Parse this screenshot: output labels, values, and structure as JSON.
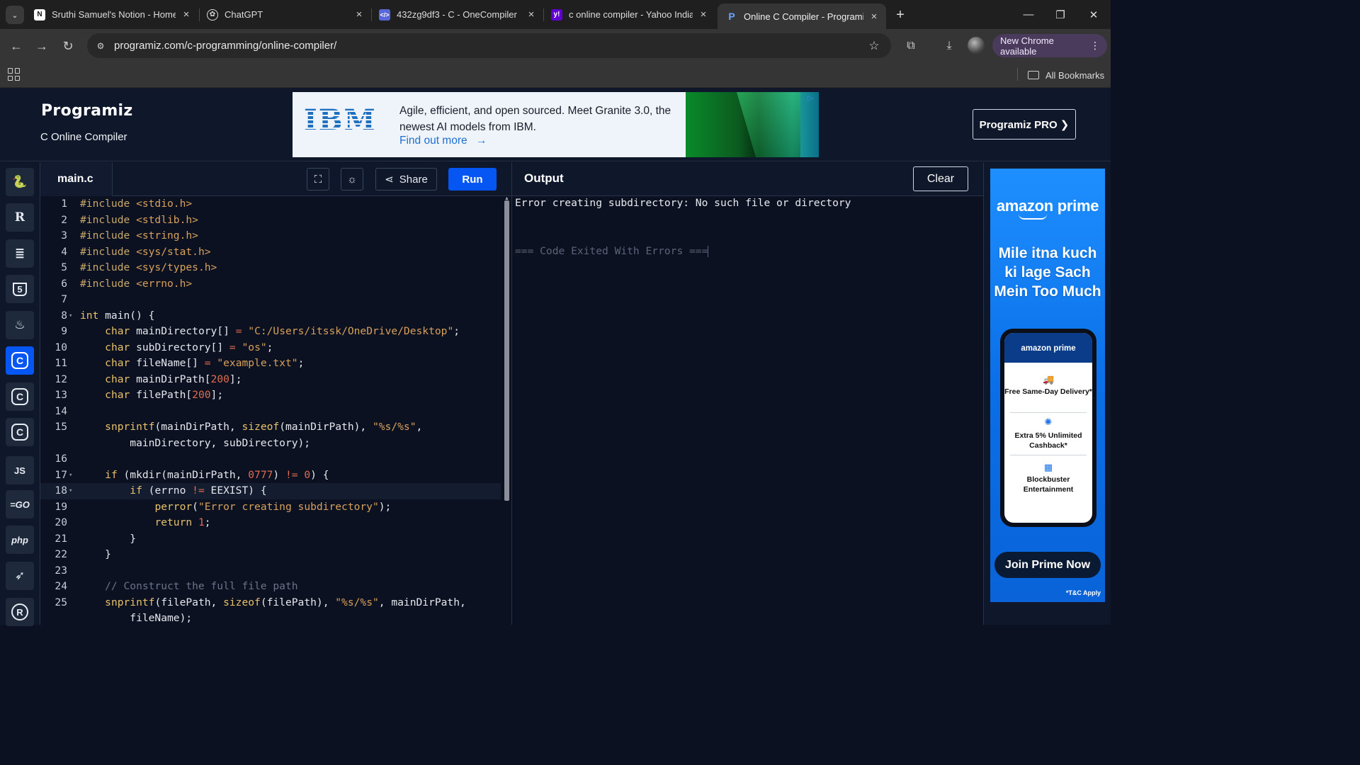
{
  "browser": {
    "tabs": [
      {
        "title": "Sruthi Samuel's Notion - Home",
        "favicon": "notion-icon",
        "active": false
      },
      {
        "title": "ChatGPT",
        "favicon": "chatgpt-icon",
        "active": false
      },
      {
        "title": "432zg9df3 - C - OneCompiler",
        "favicon": "onecompiler-icon",
        "active": false
      },
      {
        "title": "c online compiler - Yahoo India",
        "favicon": "yahoo-icon",
        "active": false
      },
      {
        "title": "Online C Compiler - Programiz",
        "favicon": "programiz-icon",
        "active": true
      }
    ],
    "url": "programiz.com/c-programming/online-compiler/",
    "new_chrome_label": "New Chrome available",
    "all_bookmarks_label": "All Bookmarks"
  },
  "header": {
    "logo": "Programiz",
    "subtitle": "C Online Compiler",
    "pro_button": "Programiz PRO ❯"
  },
  "ad_banner": {
    "brand": "IBM",
    "text": "Agile, efficient, and open sourced. Meet Granite 3.0, the newest AI models from IBM.",
    "link": "Find out more"
  },
  "sidebar": {
    "languages": [
      {
        "name": "python",
        "glyph": "🐍",
        "active": false
      },
      {
        "name": "r",
        "glyph": "R",
        "active": false
      },
      {
        "name": "sql",
        "glyph": "≣",
        "active": false
      },
      {
        "name": "html",
        "glyph": "5",
        "active": false
      },
      {
        "name": "java",
        "glyph": "♨",
        "active": false
      },
      {
        "name": "c",
        "glyph": "C",
        "active": true
      },
      {
        "name": "cpp",
        "glyph": "C",
        "active": false
      },
      {
        "name": "csharp",
        "glyph": "C",
        "active": false
      },
      {
        "name": "javascript",
        "glyph": "JS",
        "active": false
      },
      {
        "name": "go",
        "glyph": "GO",
        "active": false
      },
      {
        "name": "php",
        "glyph": "php",
        "active": false
      },
      {
        "name": "swift",
        "glyph": "➤",
        "active": false
      },
      {
        "name": "rust",
        "glyph": "R",
        "active": false
      }
    ]
  },
  "editor": {
    "file_name": "main.c",
    "share_label": "Share",
    "run_label": "Run",
    "highlighted_line": 18,
    "lines": [
      {
        "n": "1",
        "fold": false,
        "tokens": [
          [
            "pp",
            "#include "
          ],
          [
            "str",
            "<stdio.h>"
          ]
        ]
      },
      {
        "n": "2",
        "fold": false,
        "tokens": [
          [
            "pp",
            "#include "
          ],
          [
            "str",
            "<stdlib.h>"
          ]
        ]
      },
      {
        "n": "3",
        "fold": false,
        "tokens": [
          [
            "pp",
            "#include "
          ],
          [
            "str",
            "<string.h>"
          ]
        ]
      },
      {
        "n": "4",
        "fold": false,
        "tokens": [
          [
            "pp",
            "#include "
          ],
          [
            "str",
            "<sys/stat.h>"
          ]
        ]
      },
      {
        "n": "5",
        "fold": false,
        "tokens": [
          [
            "pp",
            "#include "
          ],
          [
            "str",
            "<sys/types.h>"
          ]
        ]
      },
      {
        "n": "6",
        "fold": false,
        "tokens": [
          [
            "pp",
            "#include "
          ],
          [
            "str",
            "<errno.h>"
          ]
        ]
      },
      {
        "n": "7",
        "fold": false,
        "tokens": []
      },
      {
        "n": "8",
        "fold": true,
        "tokens": [
          [
            "kw",
            "int"
          ],
          [
            "plain",
            " main() {"
          ]
        ]
      },
      {
        "n": "9",
        "fold": false,
        "tokens": [
          [
            "plain",
            "    "
          ],
          [
            "kw",
            "char"
          ],
          [
            "plain",
            " mainDirectory[] "
          ],
          [
            "op",
            "="
          ],
          [
            "plain",
            " "
          ],
          [
            "str",
            "\"C:/Users/itssk/OneDrive/Desktop\""
          ],
          [
            "plain",
            ";"
          ]
        ]
      },
      {
        "n": "10",
        "fold": false,
        "tokens": [
          [
            "plain",
            "    "
          ],
          [
            "kw",
            "char"
          ],
          [
            "plain",
            " subDirectory[] "
          ],
          [
            "op",
            "="
          ],
          [
            "plain",
            " "
          ],
          [
            "str",
            "\"os\""
          ],
          [
            "plain",
            ";"
          ]
        ]
      },
      {
        "n": "11",
        "fold": false,
        "tokens": [
          [
            "plain",
            "    "
          ],
          [
            "kw",
            "char"
          ],
          [
            "plain",
            " fileName[] "
          ],
          [
            "op",
            "="
          ],
          [
            "plain",
            " "
          ],
          [
            "str",
            "\"example.txt\""
          ],
          [
            "plain",
            ";"
          ]
        ]
      },
      {
        "n": "12",
        "fold": false,
        "tokens": [
          [
            "plain",
            "    "
          ],
          [
            "kw",
            "char"
          ],
          [
            "plain",
            " mainDirPath["
          ],
          [
            "num",
            "200"
          ],
          [
            "plain",
            "];"
          ]
        ]
      },
      {
        "n": "13",
        "fold": false,
        "tokens": [
          [
            "plain",
            "    "
          ],
          [
            "kw",
            "char"
          ],
          [
            "plain",
            " filePath["
          ],
          [
            "num",
            "200"
          ],
          [
            "plain",
            "];"
          ]
        ]
      },
      {
        "n": "14",
        "fold": false,
        "tokens": []
      },
      {
        "n": "15",
        "fold": false,
        "tokens": [
          [
            "plain",
            "    "
          ],
          [
            "kw",
            "snprintf"
          ],
          [
            "plain",
            "(mainDirPath, "
          ],
          [
            "kw",
            "sizeof"
          ],
          [
            "plain",
            "(mainDirPath), "
          ],
          [
            "str",
            "\"%s/%s\""
          ],
          [
            "plain",
            ","
          ]
        ]
      },
      {
        "n": "",
        "fold": false,
        "tokens": [
          [
            "plain",
            "        mainDirectory, subDirectory);"
          ]
        ]
      },
      {
        "n": "16",
        "fold": false,
        "tokens": []
      },
      {
        "n": "17",
        "fold": true,
        "tokens": [
          [
            "plain",
            "    "
          ],
          [
            "kw",
            "if"
          ],
          [
            "plain",
            " (mkdir(mainDirPath, "
          ],
          [
            "num",
            "0777"
          ],
          [
            "plain",
            ") "
          ],
          [
            "op",
            "!="
          ],
          [
            "plain",
            " "
          ],
          [
            "num",
            "0"
          ],
          [
            "plain",
            ") {"
          ]
        ]
      },
      {
        "n": "18",
        "fold": true,
        "tokens": [
          [
            "plain",
            "        "
          ],
          [
            "kw",
            "if"
          ],
          [
            "plain",
            " (errno "
          ],
          [
            "op",
            "!="
          ],
          [
            "plain",
            " EEXIST) {"
          ]
        ]
      },
      {
        "n": "19",
        "fold": false,
        "tokens": [
          [
            "plain",
            "            "
          ],
          [
            "kw",
            "perror"
          ],
          [
            "plain",
            "("
          ],
          [
            "str",
            "\"Error creating subdirectory\""
          ],
          [
            "plain",
            ");"
          ]
        ]
      },
      {
        "n": "20",
        "fold": false,
        "tokens": [
          [
            "plain",
            "            "
          ],
          [
            "kw",
            "return"
          ],
          [
            "plain",
            " "
          ],
          [
            "num",
            "1"
          ],
          [
            "plain",
            ";"
          ]
        ]
      },
      {
        "n": "21",
        "fold": false,
        "tokens": [
          [
            "plain",
            "        }"
          ]
        ]
      },
      {
        "n": "22",
        "fold": false,
        "tokens": [
          [
            "plain",
            "    }"
          ]
        ]
      },
      {
        "n": "23",
        "fold": false,
        "tokens": []
      },
      {
        "n": "24",
        "fold": false,
        "tokens": [
          [
            "com",
            "    // Construct the full file path"
          ]
        ]
      },
      {
        "n": "25",
        "fold": false,
        "tokens": [
          [
            "plain",
            "    "
          ],
          [
            "kw",
            "snprintf"
          ],
          [
            "plain",
            "(filePath, "
          ],
          [
            "kw",
            "sizeof"
          ],
          [
            "plain",
            "(filePath), "
          ],
          [
            "str",
            "\"%s/%s\""
          ],
          [
            "plain",
            ", mainDirPath,"
          ]
        ]
      },
      {
        "n": "",
        "fold": false,
        "tokens": [
          [
            "plain",
            "        fileName);"
          ]
        ]
      }
    ]
  },
  "output": {
    "title": "Output",
    "clear_label": "Clear",
    "error_line": "Error creating subdirectory: No such file or directory",
    "exit_line": "=== Code Exited With Errors ==="
  },
  "side_ad": {
    "brand": "amazon prime",
    "headline": "Mile itna kuch ki lage Sach Mein Too Much",
    "phone_brand": "amazon prime",
    "features": [
      "Free Same-Day Delivery*",
      "Extra 5% Unlimited Cashback*",
      "Blockbuster Entertainment"
    ],
    "cta": "Join Prime Now",
    "tnc": "*T&C Apply"
  }
}
